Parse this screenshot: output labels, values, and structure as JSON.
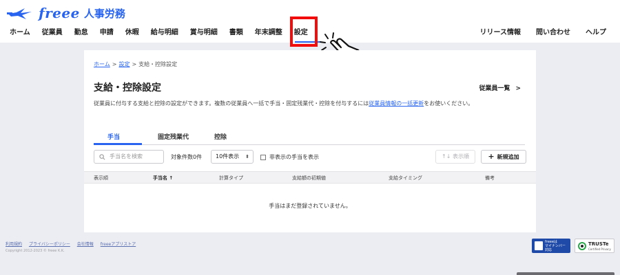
{
  "header": {
    "logo_text": "freee",
    "logo_product": "人事労務",
    "nav_left": [
      "ホーム",
      "従業員",
      "勤怠",
      "申請",
      "休暇",
      "給与明細",
      "賞与明細",
      "書類",
      "年末調整",
      "設定"
    ],
    "nav_right": [
      "リリース情報",
      "問い合わせ",
      "ヘルプ"
    ],
    "active_nav": "設定"
  },
  "breadcrumb": {
    "home": "ホーム",
    "settings": "設定",
    "current": "支給・控除設定",
    "separator": ">"
  },
  "page": {
    "title": "支給・控除設定",
    "employee_list_link": "従業員一覧",
    "employee_list_chevron": ">",
    "description_before": "従業員に付与する支給と控除の設定ができます。複数の従業員へ一括で手当・固定残業代・控除を付与するには",
    "description_link": "従業員情報の一括更新",
    "description_after": "をお使いください。"
  },
  "tabs": [
    "手当",
    "固定残業代",
    "控除"
  ],
  "active_tab": "手当",
  "toolbar": {
    "search_placeholder": "手当名を検索",
    "result_count": "対象件数0件",
    "page_size": "10件表示",
    "page_size_caret": "▲▼",
    "show_hidden_label": "非表示の手当を表示",
    "order_button": "表示順",
    "order_icon": "↑↓",
    "add_button": "新規追加",
    "add_icon": "+"
  },
  "table": {
    "columns": [
      "表示順",
      "手当名 ↑",
      "計算タイプ",
      "支給額の初期値",
      "支給タイミング",
      "備考"
    ],
    "rows": [],
    "empty_message": "手当はまだ登録されていません。"
  },
  "footer": {
    "links": [
      "利用規約",
      "プライバシーポリシー",
      "会社情報",
      "freeeアプリストア"
    ],
    "copyright": "Copyright 2012-2023 © freee K.K.",
    "mynumber_badge": [
      "freeeは",
      "マイナンバー",
      "対応"
    ],
    "truste_title": "TRUSTe",
    "truste_sub": "Certified Privacy"
  },
  "colors": {
    "brand": "#2864f0",
    "highlight": "#f20c0c",
    "background": "#ecedf2"
  },
  "icons": {
    "logo": "freee-bird-logo-icon",
    "pointer": "pointing-hand-cursor-icon",
    "search": "search-icon",
    "checkbox": "checkbox-icon",
    "truste": "truste-seal-icon",
    "mynumber": "mynumber-card-icon"
  }
}
